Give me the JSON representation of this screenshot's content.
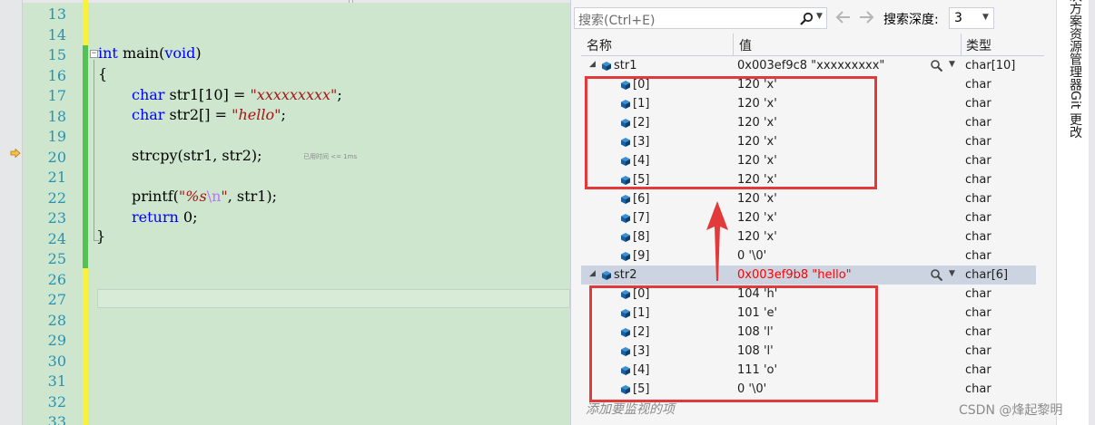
{
  "editor": {
    "line_numbers": [
      "13",
      "14",
      "15",
      "16",
      "17",
      "18",
      "19",
      "20",
      "21",
      "22",
      "23",
      "24",
      "25",
      "26",
      "27",
      "28",
      "29",
      "30",
      "31",
      "32",
      "33"
    ],
    "code": {
      "l15_kw": "int",
      "l15_rest": " main(",
      "l15_kw2": "void",
      "l15_close": ")",
      "l16": "{",
      "l17_kw": "char",
      "l17_rest": " str1[10] = ",
      "l17_str": "\"xxxxxxxxx\"",
      "l17_end": ";",
      "l18_kw": "char",
      "l18_rest": " str2[] = ",
      "l18_str": "\"hello\"",
      "l18_end": ";",
      "l20": "strcpy(str1, str2);",
      "l20_timing": "已用时间 <= 1ms",
      "l22_fn": "printf(",
      "l22_str1": "\"%s",
      "l22_esc": "\\n",
      "l22_str2": "\"",
      "l22_rest": ", str1);",
      "l23_kw": "return",
      "l23_rest": " 0;",
      "l24": "}"
    }
  },
  "watch": {
    "search_placeholder": "搜索(Ctrl+E)",
    "search_depth_label": "搜索深度:",
    "search_depth_value": "3",
    "columns": {
      "name": "名称",
      "value": "值",
      "type": "类型"
    },
    "str1": {
      "name": "str1",
      "value": "0x003ef9c8 \"xxxxxxxxx\"",
      "type": "char[10]"
    },
    "str1_items": [
      {
        "name": "[0]",
        "value": "120 'x'",
        "type": "char"
      },
      {
        "name": "[1]",
        "value": "120 'x'",
        "type": "char"
      },
      {
        "name": "[2]",
        "value": "120 'x'",
        "type": "char"
      },
      {
        "name": "[3]",
        "value": "120 'x'",
        "type": "char"
      },
      {
        "name": "[4]",
        "value": "120 'x'",
        "type": "char"
      },
      {
        "name": "[5]",
        "value": "120 'x'",
        "type": "char"
      },
      {
        "name": "[6]",
        "value": "120 'x'",
        "type": "char"
      },
      {
        "name": "[7]",
        "value": "120 'x'",
        "type": "char"
      },
      {
        "name": "[8]",
        "value": "120 'x'",
        "type": "char"
      },
      {
        "name": "[9]",
        "value": "0 '\\0'",
        "type": "char"
      }
    ],
    "str2": {
      "name": "str2",
      "value": "0x003ef9b8 \"hello\"",
      "type": "char[6]"
    },
    "str2_items": [
      {
        "name": "[0]",
        "value": "104 'h'",
        "type": "char"
      },
      {
        "name": "[1]",
        "value": "101 'e'",
        "type": "char"
      },
      {
        "name": "[2]",
        "value": "108 'l'",
        "type": "char"
      },
      {
        "name": "[3]",
        "value": "108 'l'",
        "type": "char"
      },
      {
        "name": "[4]",
        "value": "111 'o'",
        "type": "char"
      },
      {
        "name": "[5]",
        "value": "0 '\\0'",
        "type": "char"
      }
    ],
    "add_watch_hint": "添加要监视的项"
  },
  "tool_strip": {
    "solution_explorer": "解决方案资源管理器",
    "git_changes": "Git 更改"
  },
  "watermark": "CSDN @烽起黎明",
  "colors": {
    "editor_bg": "#cde6cd",
    "keyword": "#0000ff",
    "string": "#a31515",
    "line_number": "#2b91af",
    "changed_value": "#ff0000",
    "annotation": "#e23a3a",
    "selection": "#ccd4e1"
  },
  "icons": [
    "breakpoint-arrow-icon",
    "search-icon",
    "back-arrow-icon",
    "forward-arrow-icon",
    "variable-cube-icon",
    "magnifier-icon",
    "annotation-arrow-icon"
  ]
}
